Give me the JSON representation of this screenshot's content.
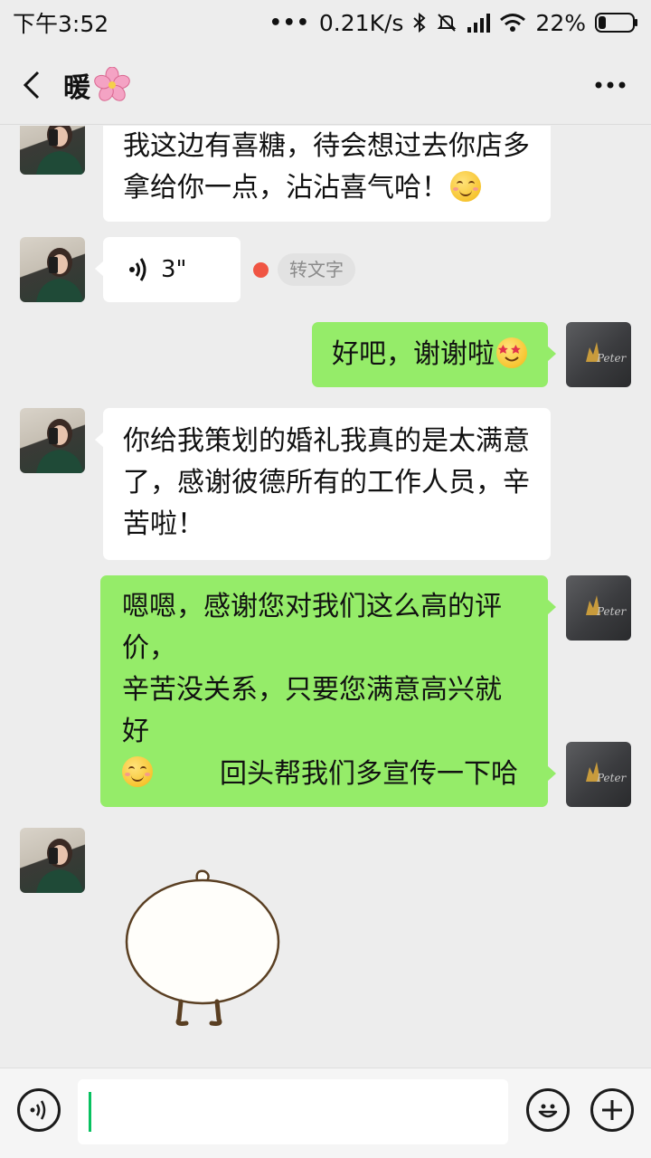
{
  "status_bar": {
    "time": "下午3:52",
    "network_speed": "0.21K/s",
    "battery": "22%",
    "icons": [
      "more-dots-icon",
      "bluetooth-icon",
      "mute-icon",
      "signal-icon",
      "wifi-icon",
      "battery-icon"
    ]
  },
  "nav": {
    "title": "暖",
    "title_icon": "sakura-flower-icon"
  },
  "messages": [
    {
      "side": "in",
      "type": "text",
      "lines": [
        "我这边有喜糖，待会想过去你店多",
        "拿给你一点，沾沾喜气哈！"
      ],
      "emoji": "smile-emoji"
    },
    {
      "side": "in",
      "type": "voice",
      "duration": "3\"",
      "unread": true,
      "action": "转文字"
    },
    {
      "side": "out",
      "type": "text",
      "lines": [
        "好吧，谢谢啦"
      ],
      "emoji": "star-struck-emoji"
    },
    {
      "side": "in",
      "type": "text",
      "lines": [
        "你给我策划的婚礼我真的是太满意",
        "了，感谢彼德所有的工作人员，辛",
        "苦啦！"
      ]
    },
    {
      "side": "out",
      "type": "text",
      "lines": [
        "嗯嗯，感谢您对我们这么高的评价，",
        "辛苦没关系，只要您满意高兴就好"
      ],
      "emoji": "smile-emoji"
    },
    {
      "side": "out",
      "type": "text",
      "lines": [
        "回头帮我们多宣传一下哈"
      ]
    },
    {
      "side": "in",
      "type": "sticker",
      "sticker": "steamed-bun-sticker"
    }
  ],
  "input_bar": {
    "value": "",
    "voice_icon": "voice-input-icon",
    "emoji_icon": "emoji-icon",
    "plus_icon": "plus-icon"
  },
  "colors": {
    "background": "#ededed",
    "incoming_bubble": "#ffffff",
    "outgoing_bubble": "#95ec69",
    "caret": "#07c160",
    "unread_dot": "#f05543"
  }
}
